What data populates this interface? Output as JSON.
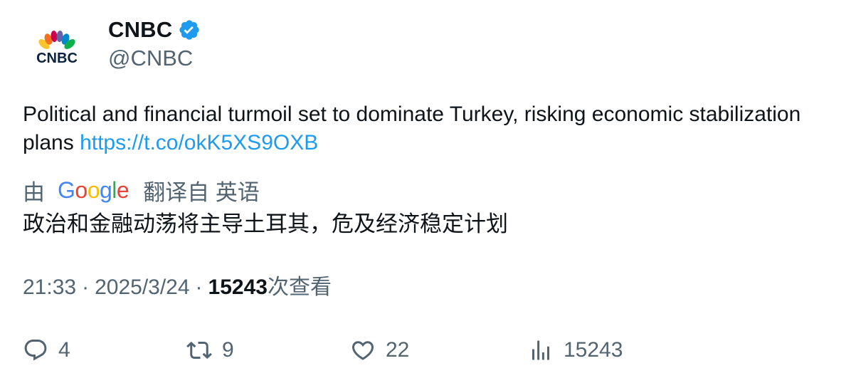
{
  "author": {
    "name": "CNBC",
    "handle": "@CNBC",
    "avatar_text": "CNBC"
  },
  "tweet": {
    "text": "Political and financial turmoil set to dominate Turkey, risking economic stabilization plans",
    "link": "https://t.co/okK5XS9OXB"
  },
  "translation": {
    "prefix": "由",
    "provider": "Google",
    "suffix": "翻译自 英语",
    "text": "政治和金融动荡将主导土耳其，危及经济稳定计划"
  },
  "meta": {
    "time": "21:33",
    "separator": "·",
    "date": "2025/3/24",
    "views_count": "15243",
    "views_label": "次查看"
  },
  "actions": {
    "reply_count": "4",
    "retweet_count": "9",
    "like_count": "22",
    "views_count": "15243"
  },
  "colors": {
    "text": "#0f1419",
    "secondary": "#536471",
    "link": "#1d9bf0",
    "verified": "#1d9bf0"
  },
  "icons": [
    "verified-badge-icon",
    "reply-icon",
    "retweet-icon",
    "like-icon",
    "views-icon"
  ]
}
